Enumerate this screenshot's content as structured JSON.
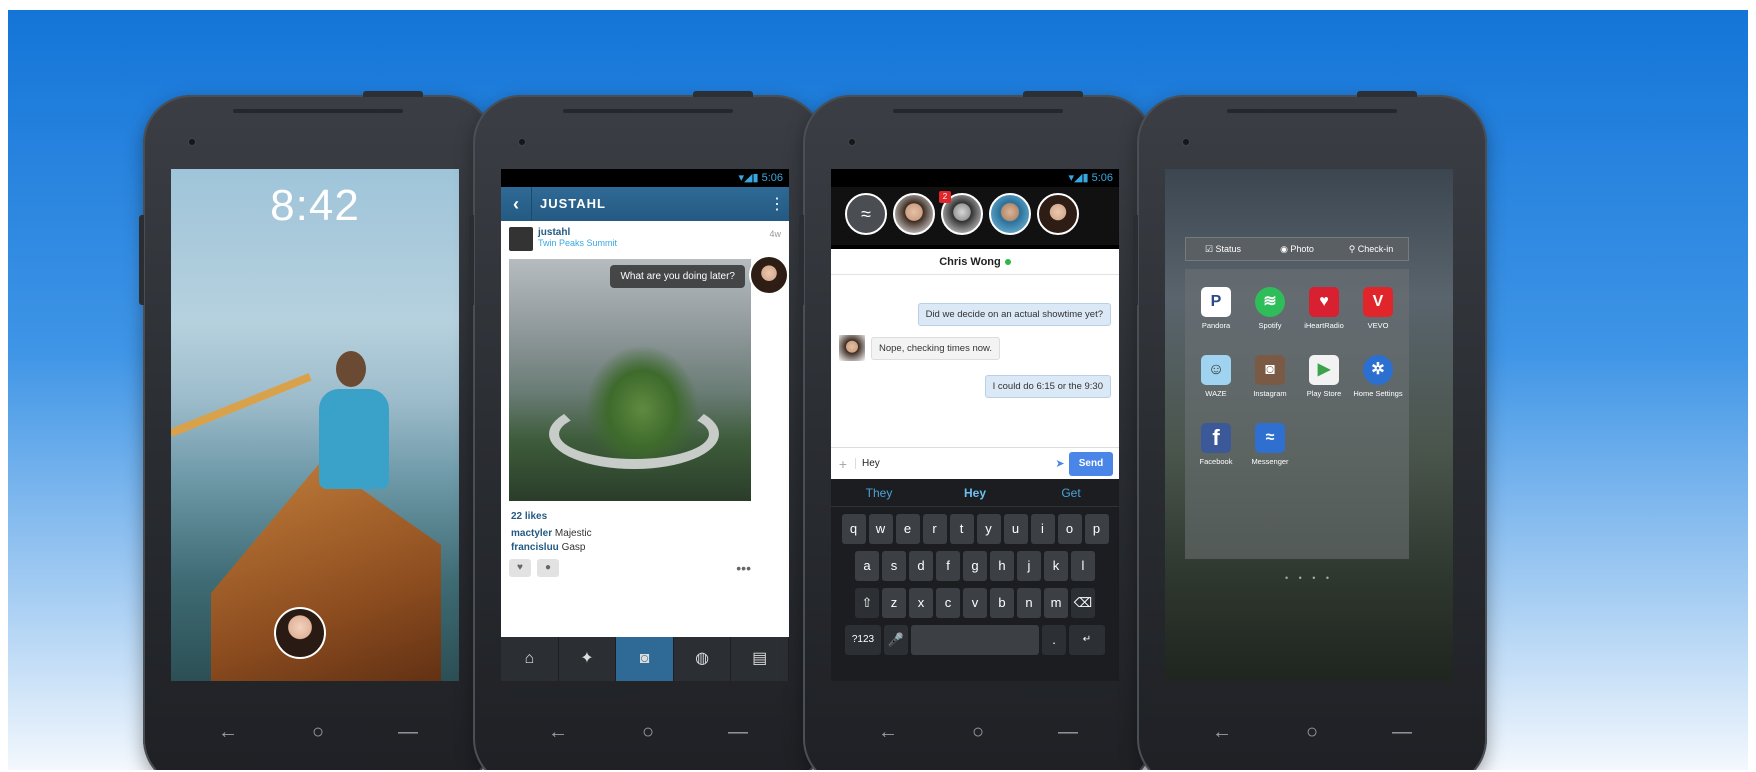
{
  "phones": {
    "lock": {
      "time": "8:42"
    },
    "instagram": {
      "status": "▾◢▮ 5:06",
      "header_title": "JUSTAHL",
      "back_icon": "‹",
      "more_icon": "⋮",
      "username": "justahl",
      "location": "Twin Peaks Summit",
      "age": "4w",
      "chat_bubble": "What are you doing later?",
      "likes": "22 likes",
      "comments": [
        {
          "user": "mactyler",
          "text": "Majestic"
        },
        {
          "user": "francisluu",
          "text": "Gasp"
        }
      ],
      "tabs": [
        "⌂",
        "✦",
        "◙",
        "◍",
        "▤"
      ]
    },
    "messenger": {
      "status": "▾◢▮ 5:06",
      "badge": "2",
      "chat_name": "Chris Wong",
      "messages": [
        {
          "from": "me",
          "text": "Did we decide on an actual showtime yet?"
        },
        {
          "from": "them",
          "text": "Nope, checking times now."
        },
        {
          "from": "me",
          "text": "I could do 6:15 or the 9:30"
        }
      ],
      "input_value": "Hey",
      "send_label": "Send",
      "suggestions": [
        "They",
        "Hey",
        "Get"
      ],
      "kb_row1": [
        "q",
        "w",
        "e",
        "r",
        "t",
        "y",
        "u",
        "i",
        "o",
        "p"
      ],
      "kb_row2": [
        "a",
        "s",
        "d",
        "f",
        "g",
        "h",
        "j",
        "k",
        "l"
      ],
      "kb_row3": [
        "⇧",
        "z",
        "x",
        "c",
        "v",
        "b",
        "n",
        "m",
        "⌫"
      ],
      "kb_row4": [
        "?123",
        "🎤",
        "",
        ".",
        "↵"
      ]
    },
    "home": {
      "actions": [
        "☑ Status",
        "◉ Photo",
        "⚲ Check-in"
      ],
      "apps": [
        {
          "label": "Pandora",
          "glyph": "P",
          "color": "#ffffff"
        },
        {
          "label": "Spotify",
          "glyph": "≋",
          "color": "#2ebd59"
        },
        {
          "label": "iHeartRadio",
          "glyph": "♥",
          "color": "#d92030"
        },
        {
          "label": "VEVO",
          "glyph": "V",
          "color": "#e0262b"
        },
        {
          "label": "WAZE",
          "glyph": "☺",
          "color": "#9fd3ef"
        },
        {
          "label": "Instagram",
          "glyph": "◙",
          "color": "#7a5a45"
        },
        {
          "label": "Play Store",
          "glyph": "▶",
          "color": "#f2f2f2"
        },
        {
          "label": "Home Settings",
          "glyph": "✲",
          "color": "#2b6fd0"
        },
        {
          "label": "Facebook",
          "glyph": "f",
          "color": "#3b5998"
        },
        {
          "label": "Messenger",
          "glyph": "≈",
          "color": "#2f6fd0"
        }
      ],
      "pager": "• • • •"
    },
    "nav": [
      "←",
      "○",
      "—"
    ]
  }
}
